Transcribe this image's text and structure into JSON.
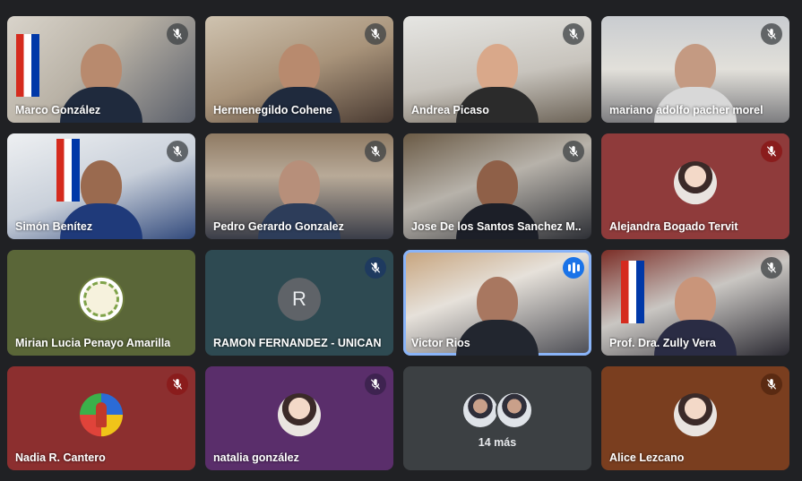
{
  "meeting": {
    "participants": [
      {
        "name": "Marco González",
        "mic": "muted"
      },
      {
        "name": "Hermenegildo Cohene",
        "mic": "muted"
      },
      {
        "name": "Andrea Picaso",
        "mic": "muted"
      },
      {
        "name": "mariano adolfo pacher morel",
        "mic": "muted"
      },
      {
        "name": "Simón Benítez",
        "mic": "muted"
      },
      {
        "name": "Pedro Gerardo Gonzalez",
        "mic": "muted"
      },
      {
        "name": "Jose De los Santos Sanchez M...",
        "mic": "muted"
      },
      {
        "name": "Alejandra Bogado Tervit",
        "mic": "muted"
      },
      {
        "name": "Mirian Lucia Penayo Amarilla",
        "mic": "none"
      },
      {
        "name": "RAMON FERNANDEZ - UNICAN",
        "mic": "muted",
        "avatar_letter": "R"
      },
      {
        "name": "Victor Rios",
        "mic": "speaking"
      },
      {
        "name": "Prof. Dra. Zully Vera",
        "mic": "muted"
      },
      {
        "name": "Nadia R. Cantero",
        "mic": "muted"
      },
      {
        "name": "natalia gonzález",
        "mic": "muted"
      },
      {
        "name": "",
        "mic": "none"
      },
      {
        "name": "Alice Lezcano",
        "mic": "muted"
      }
    ],
    "overflow_label": "14 más",
    "icons": {
      "muted": "mic-off-icon",
      "speaking": "audio-level-icon"
    },
    "colors": {
      "background": "#202124",
      "active_speaker_border": "#8ab4f8",
      "speaking_indicator": "#1a73e8"
    }
  }
}
